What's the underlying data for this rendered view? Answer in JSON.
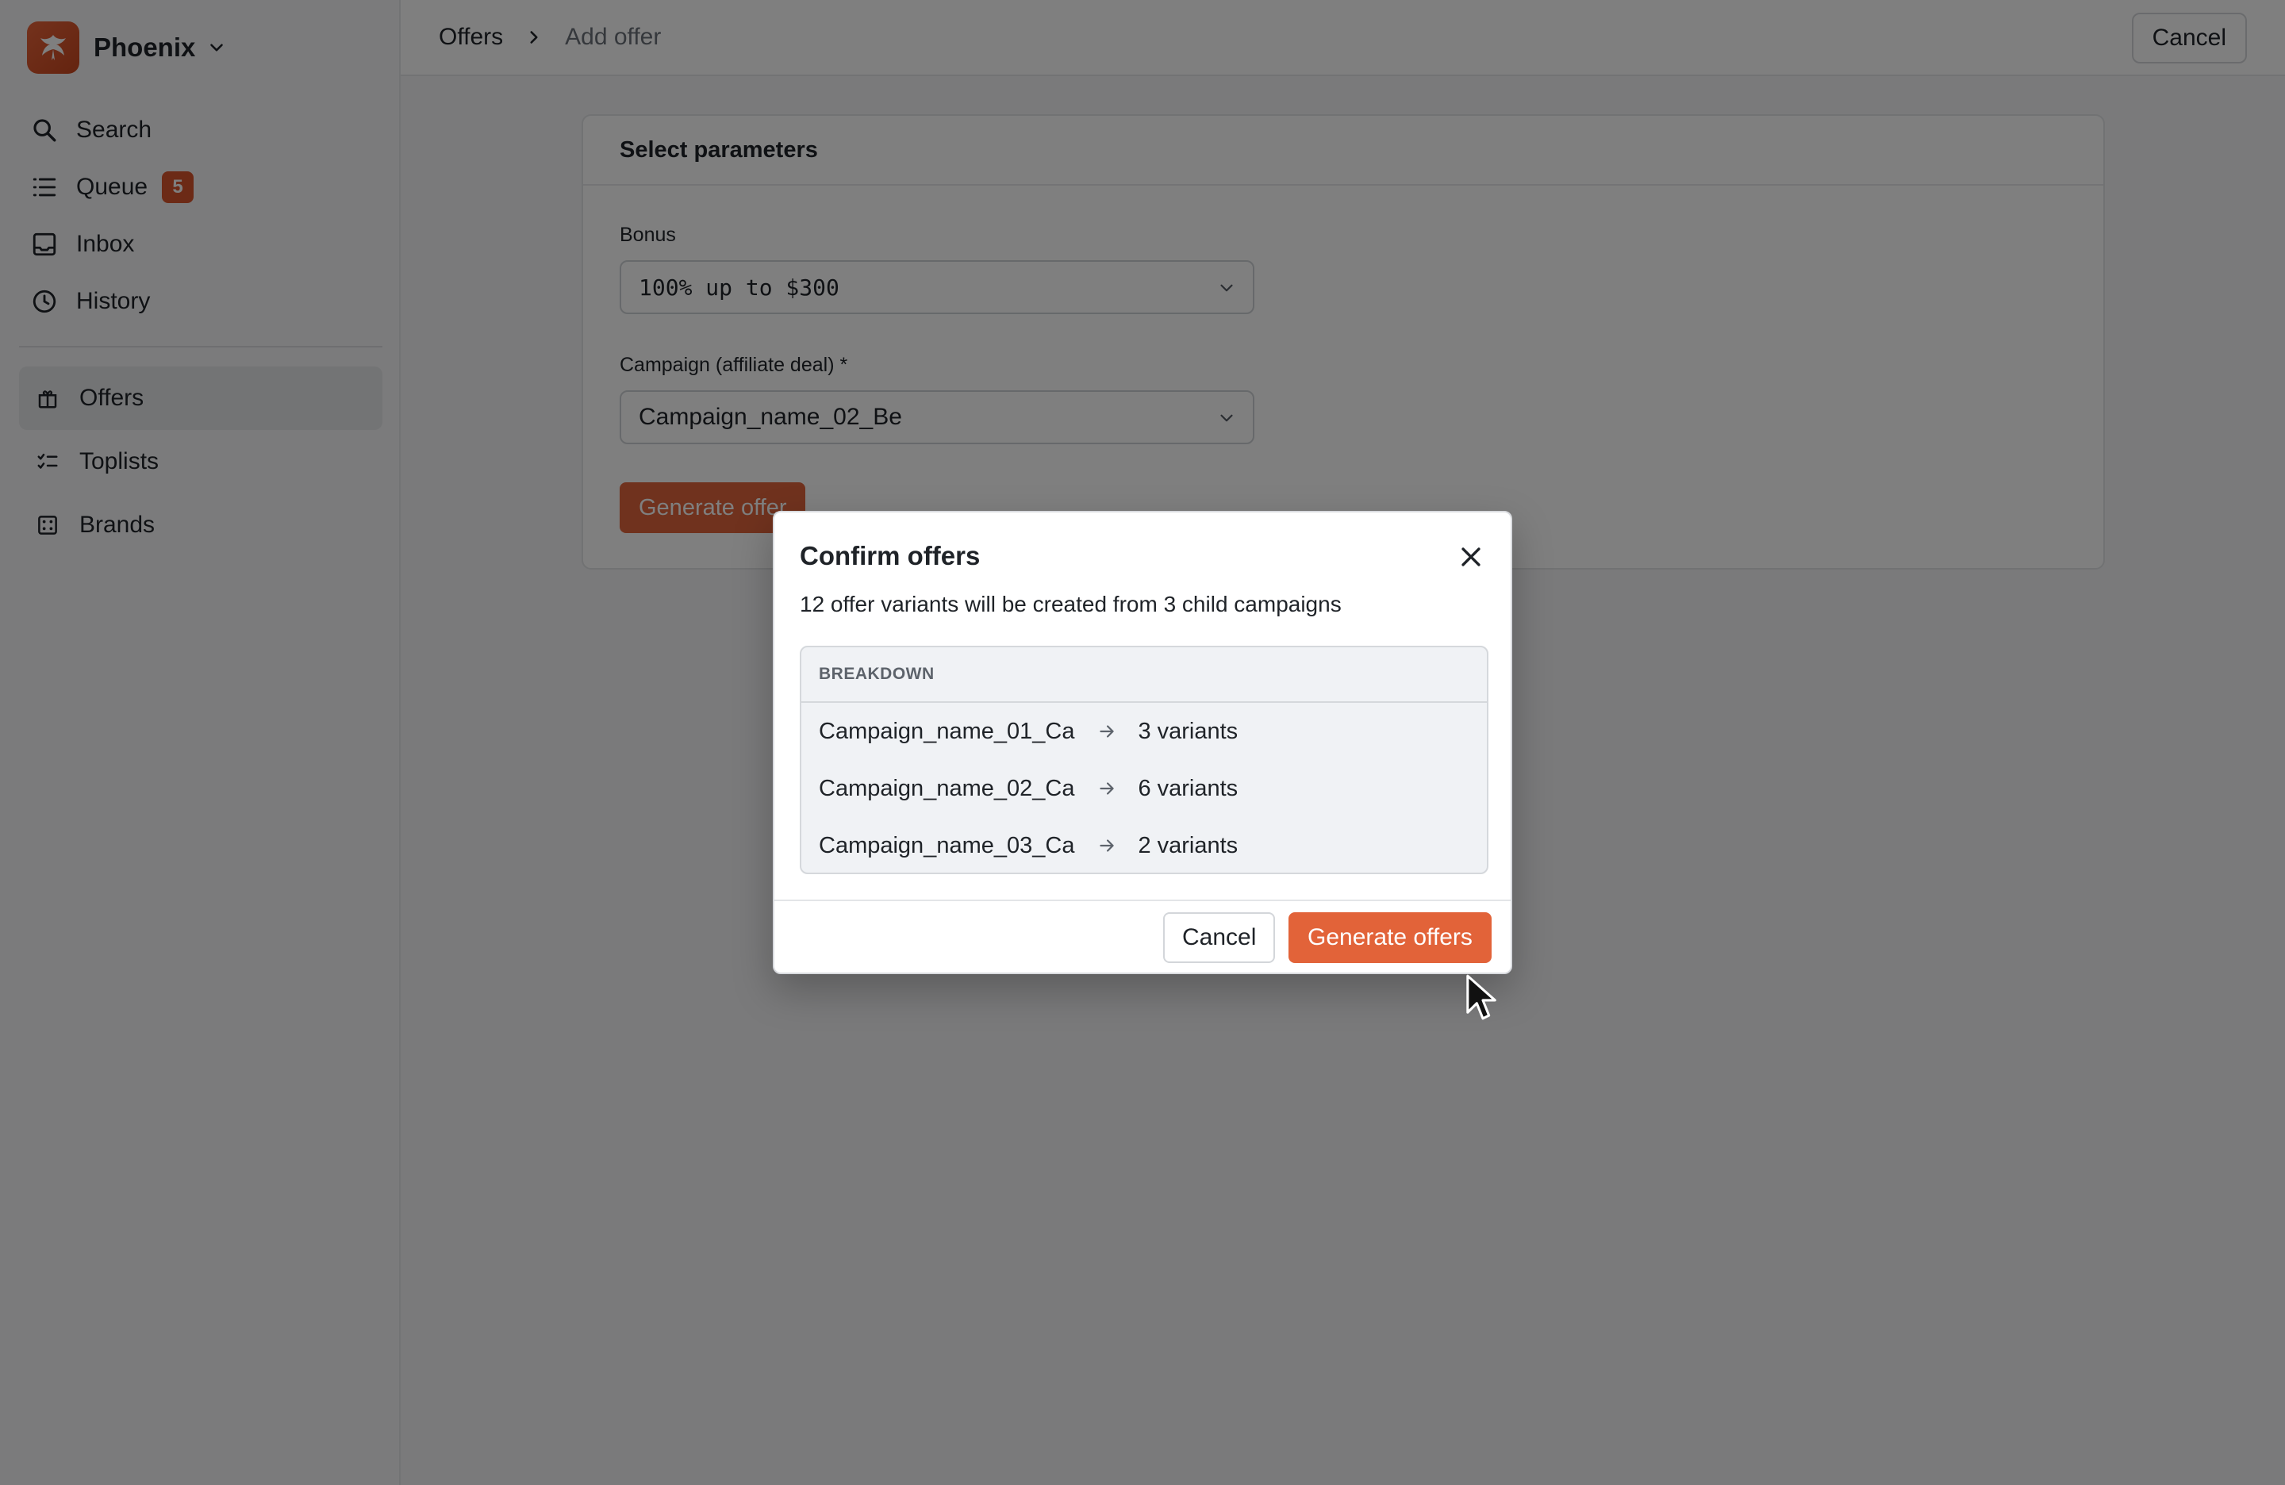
{
  "brand": {
    "name": "Phoenix"
  },
  "nav_primary": [
    {
      "label": "Search",
      "icon": "search-icon"
    },
    {
      "label": "Queue",
      "icon": "list-icon",
      "badge": "5"
    },
    {
      "label": "Inbox",
      "icon": "inbox-icon"
    },
    {
      "label": "History",
      "icon": "clock-icon"
    }
  ],
  "nav_secondary": [
    {
      "label": "Offers",
      "icon": "gift-icon",
      "active": true
    },
    {
      "label": "Toplists",
      "icon": "checklist-icon"
    },
    {
      "label": "Brands",
      "icon": "dice-icon"
    }
  ],
  "breadcrumb": {
    "parent": "Offers",
    "current": "Add offer"
  },
  "top_cancel": "Cancel",
  "form": {
    "heading": "Select parameters",
    "bonus_label": "Bonus",
    "bonus_value": "100% up to $300",
    "campaign_label": "Campaign (affiliate deal) *",
    "campaign_value": "Campaign_name_02_Be",
    "generate_label": "Generate offer"
  },
  "modal": {
    "title": "Confirm offers",
    "subtitle": "12 offer variants will be created from 3 child campaigns",
    "breakdown_heading": "BREAKDOWN",
    "rows": [
      {
        "campaign": "Campaign_name_01_Ca",
        "variants": "3 variants"
      },
      {
        "campaign": "Campaign_name_02_Ca",
        "variants": "6 variants"
      },
      {
        "campaign": "Campaign_name_03_Ca",
        "variants": "2 variants"
      }
    ],
    "cancel_label": "Cancel",
    "confirm_label": "Generate offers"
  },
  "colors": {
    "accent": "#e26339",
    "badge": "#d9552d",
    "overlay": "rgba(0,0,0,0.5)"
  }
}
